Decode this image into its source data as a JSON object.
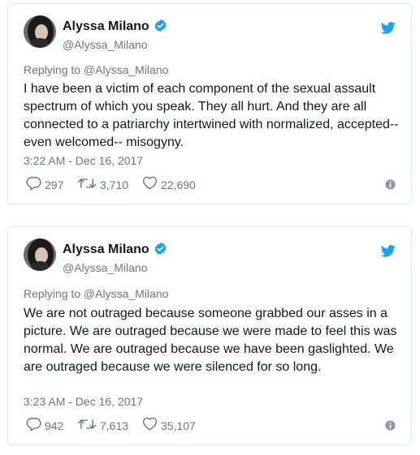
{
  "colors": {
    "twitter_blue": "#1da1f2",
    "text": "#14171a",
    "muted": "#657786",
    "border": "#e1e8ed"
  },
  "tweets": [
    {
      "author_name": "Alyssa Milano",
      "author_handle": "@Alyssa_Milano",
      "replying_to": "Replying to @Alyssa_Milano",
      "text": "I have been a victim of each component of the sexual assault spectrum of which you speak. They all hurt. And they are all connected to a patriarchy intertwined with normalized, accepted--even welcomed-- misogyny.",
      "timestamp": "3:22 AM - Dec 16, 2017",
      "replies": "297",
      "retweets": "3,710",
      "likes": "22,690"
    },
    {
      "author_name": "Alyssa Milano",
      "author_handle": "@Alyssa_Milano",
      "replying_to": "Replying to @Alyssa_Milano",
      "text": "We are not outraged because someone grabbed our asses in a picture. We are outraged because we were made to feel this was normal. We are outraged because we have been gaslighted. We are outraged because we were silenced for so long.",
      "timestamp": "3:23 AM - Dec 16, 2017",
      "replies": "942",
      "retweets": "7,613",
      "likes": "35,107"
    }
  ],
  "icons": {
    "verified": "verified-badge-icon",
    "brand": "twitter-bird-icon",
    "reply": "reply-icon",
    "retweet": "retweet-icon",
    "like": "heart-icon",
    "info": "info-icon"
  }
}
